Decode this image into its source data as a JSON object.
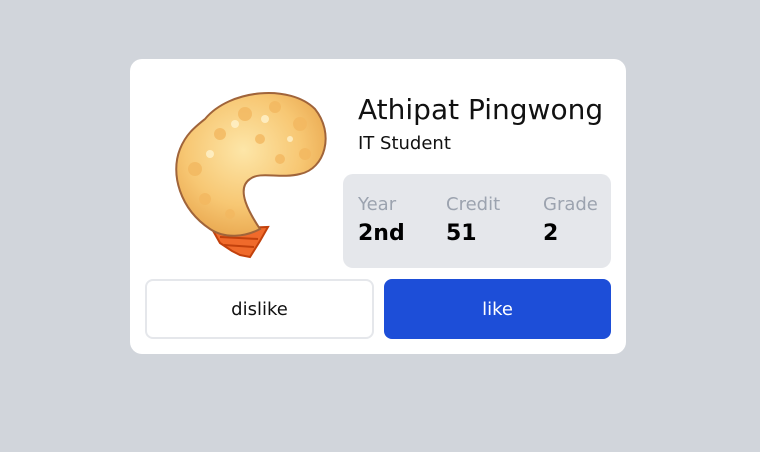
{
  "profile": {
    "name": "Athipat Pingwong",
    "role": "IT Student",
    "avatar_icon": "fried-shrimp-icon"
  },
  "stats": [
    {
      "label": "Year",
      "value": "2nd"
    },
    {
      "label": "Credit",
      "value": "51"
    },
    {
      "label": "Grade",
      "value": "2"
    }
  ],
  "actions": {
    "dislike_label": "dislike",
    "like_label": "like"
  },
  "colors": {
    "background": "#d1d5db",
    "card": "#ffffff",
    "stats_panel": "#e5e7eb",
    "like_button": "#1d4ed8",
    "stat_label": "#9ca3af"
  }
}
